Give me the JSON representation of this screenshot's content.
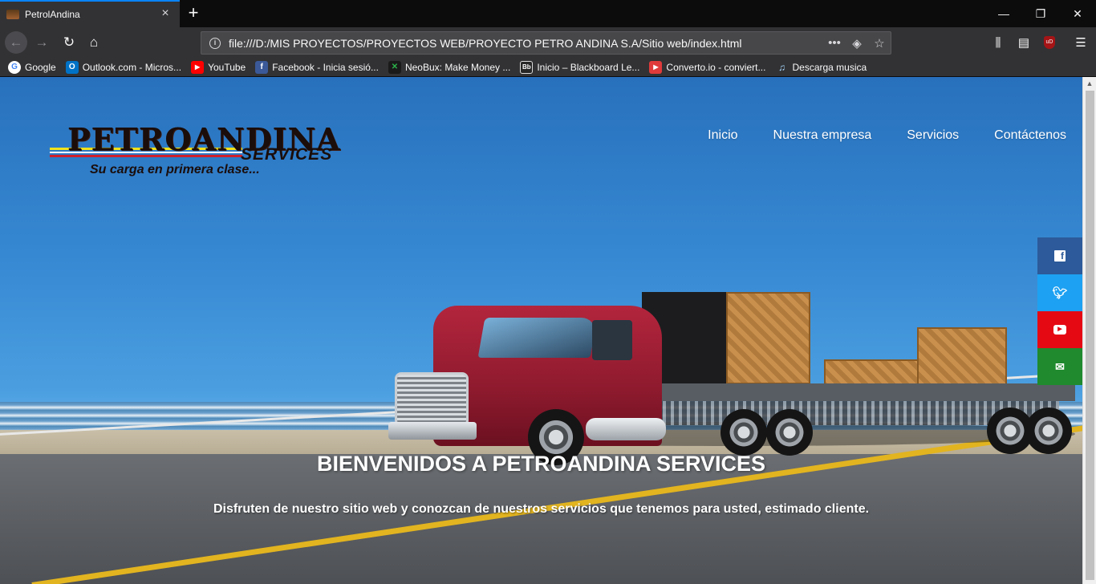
{
  "browser": {
    "tab_title": "PetrolAndina",
    "url": "file:///D:/MIS PROYECTOS/PROYECTOS WEB/PROYECTO PETRO ANDINA S.A/Sitio web/index.html",
    "accent_color": "#0a84ff",
    "bookmarks": [
      {
        "label": "Google",
        "icon": "google-icon",
        "color": "#ffffff"
      },
      {
        "label": "Outlook.com - Micros...",
        "icon": "outlook-icon",
        "color": "#0072c6"
      },
      {
        "label": "YouTube",
        "icon": "youtube-icon",
        "color": "#ff0000"
      },
      {
        "label": "Facebook - Inicia sesió...",
        "icon": "facebook-icon",
        "color": "#3b5998"
      },
      {
        "label": "NeoBux: Make Money ...",
        "icon": "neobux-icon",
        "color": "#2bb34a"
      },
      {
        "label": "Inicio – Blackboard Le...",
        "icon": "blackboard-icon",
        "color": "#262626"
      },
      {
        "label": "Converto.io - conviert...",
        "icon": "converto-icon",
        "color": "#e03a3a"
      },
      {
        "label": "Descarga musica",
        "icon": "music-note-icon",
        "color": "#323234"
      }
    ]
  },
  "page": {
    "logo": {
      "main": "PETROANDINA",
      "sub": "SERVICES",
      "tagline": "Su carga en primera clase..."
    },
    "menu": [
      "Inicio",
      "Nuestra empresa",
      "Servicios",
      "Contáctenos"
    ],
    "social": [
      {
        "name": "facebook",
        "icon": "facebook-icon",
        "color": "#2c5a9a"
      },
      {
        "name": "twitter",
        "icon": "twitter-icon",
        "color": "#1da1f2"
      },
      {
        "name": "youtube",
        "icon": "youtube-icon",
        "color": "#e50914"
      },
      {
        "name": "email",
        "icon": "email-icon",
        "color": "#1f8a2e"
      }
    ],
    "hero_title": "BIENVENIDOS A PETROANDINA SERVICES",
    "hero_subtitle": "Disfruten de nuestro sitio web y conozcan de nuestros servicios que tenemos para usted, estimado cliente."
  }
}
